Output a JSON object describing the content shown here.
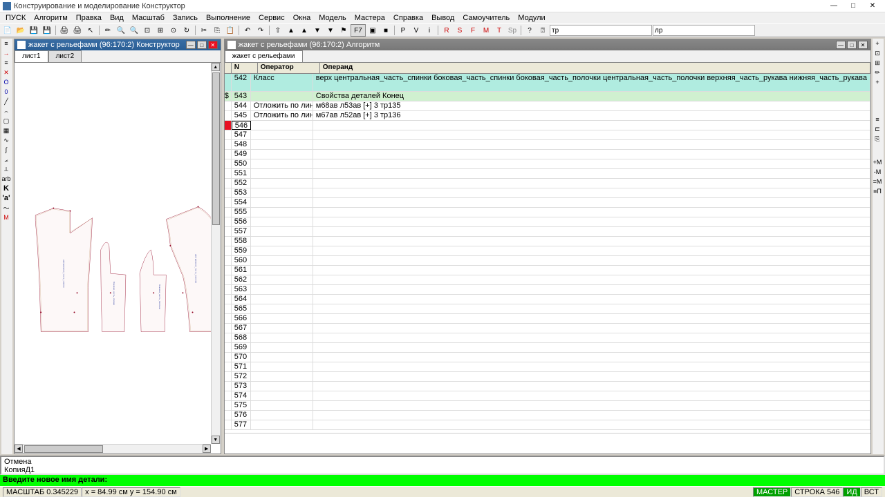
{
  "app": {
    "title": "Конструирование и моделирование  Конструктор"
  },
  "menu": [
    "ПУСК",
    "Алгоритм",
    "Правка",
    "Вид",
    "Масштаб",
    "Запись",
    "Выполнение",
    "Сервис",
    "Окна",
    "Модель",
    "Мастера",
    "Справка",
    "Вывод",
    "Самоучитель",
    "Модули"
  ],
  "toolbar": {
    "combo1": "тр",
    "combo2": "лр"
  },
  "panels": {
    "left": {
      "title": "жакет с рельефами (96:170:2) Конструктор",
      "tabs": [
        "лист1",
        "лист2"
      ]
    },
    "right": {
      "title": "жакет с рельефами (96:170:2) Алгоритм",
      "tab": "жакет с рельефами"
    }
  },
  "table": {
    "headers": {
      "n": "N",
      "op": "Оператор",
      "opd": "Операнд"
    },
    "rows": [
      {
        "n": "542",
        "op": "Класс",
        "opd": "верх центральная_часть_спинки боковая_часть_спинки боковая_часть_полочки центральная_часть_полочки верхняя_часть_рукава нижняя_часть_рукава",
        "hl": "cyan"
      },
      {
        "n": "543",
        "op": "",
        "opd": "Свойства деталей Конец",
        "hl": "green",
        "mark": "$"
      },
      {
        "n": "544",
        "op": "Отложить по линии",
        "opd": "м68ав л53ав [+] 3 тр135",
        "hl": ""
      },
      {
        "n": "545",
        "op": "Отложить по линии",
        "opd": "м67ав л52ав [+] 3 тр136",
        "hl": ""
      },
      {
        "n": "546",
        "op": "",
        "opd": "",
        "hl": "",
        "marker": "red",
        "edit": true
      },
      {
        "n": "547",
        "op": "",
        "opd": ""
      },
      {
        "n": "548",
        "op": "",
        "opd": ""
      },
      {
        "n": "549",
        "op": "",
        "opd": ""
      },
      {
        "n": "550",
        "op": "",
        "opd": ""
      },
      {
        "n": "551",
        "op": "",
        "opd": ""
      },
      {
        "n": "552",
        "op": "",
        "opd": ""
      },
      {
        "n": "553",
        "op": "",
        "opd": ""
      },
      {
        "n": "554",
        "op": "",
        "opd": ""
      },
      {
        "n": "555",
        "op": "",
        "opd": ""
      },
      {
        "n": "556",
        "op": "",
        "opd": ""
      },
      {
        "n": "557",
        "op": "",
        "opd": ""
      },
      {
        "n": "558",
        "op": "",
        "opd": ""
      },
      {
        "n": "559",
        "op": "",
        "opd": ""
      },
      {
        "n": "560",
        "op": "",
        "opd": ""
      },
      {
        "n": "561",
        "op": "",
        "opd": ""
      },
      {
        "n": "562",
        "op": "",
        "opd": ""
      },
      {
        "n": "563",
        "op": "",
        "opd": ""
      },
      {
        "n": "564",
        "op": "",
        "opd": ""
      },
      {
        "n": "565",
        "op": "",
        "opd": ""
      },
      {
        "n": "566",
        "op": "",
        "opd": ""
      },
      {
        "n": "567",
        "op": "",
        "opd": ""
      },
      {
        "n": "568",
        "op": "",
        "opd": ""
      },
      {
        "n": "569",
        "op": "",
        "opd": ""
      },
      {
        "n": "570",
        "op": "",
        "opd": ""
      },
      {
        "n": "571",
        "op": "",
        "opd": ""
      },
      {
        "n": "572",
        "op": "",
        "opd": ""
      },
      {
        "n": "573",
        "op": "",
        "opd": ""
      },
      {
        "n": "574",
        "op": "",
        "opd": ""
      },
      {
        "n": "575",
        "op": "",
        "opd": ""
      },
      {
        "n": "576",
        "op": "",
        "opd": ""
      },
      {
        "n": "577",
        "op": "",
        "opd": ""
      }
    ]
  },
  "console": {
    "line1": "Отмена",
    "line2": "КопияД1"
  },
  "prompt": "Введите новое имя детали:",
  "status": {
    "scale": "МАСШТАБ 0.345229",
    "coords": "x = 84.99 см   y = 154.90 см",
    "master": "МАСТЕР",
    "row": "СТРОКА 546",
    "id": "ИД",
    "vst": "ВСТ"
  }
}
